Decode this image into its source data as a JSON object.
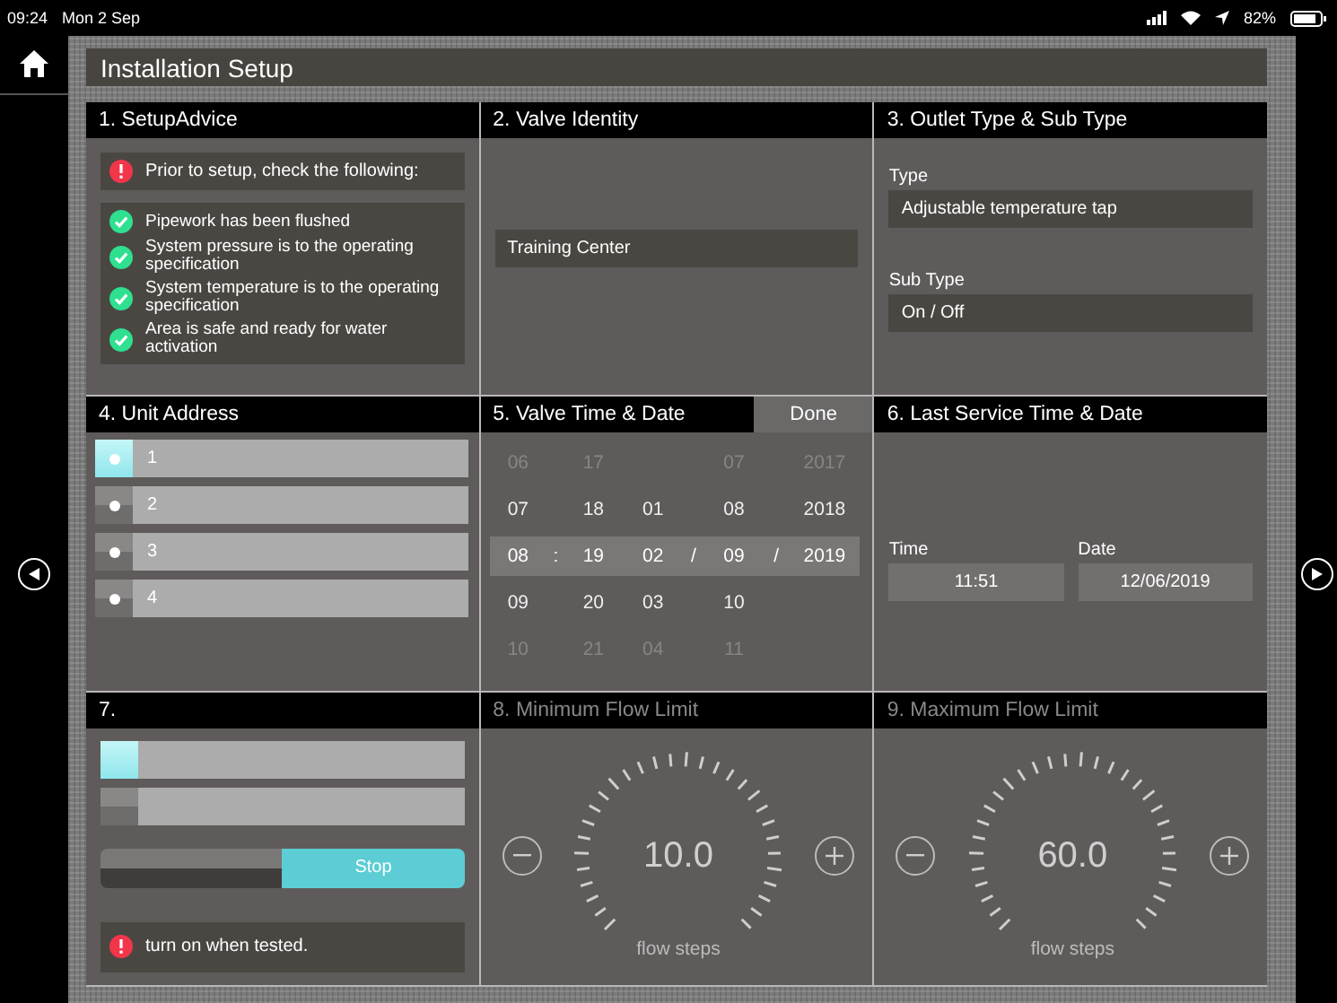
{
  "status_bar": {
    "time": "09:24",
    "date": "Mon 2 Sep",
    "battery": "82%"
  },
  "title": "Installation Setup",
  "advice": {
    "title": "1. SetupAdvice",
    "warning": "Prior to setup, check the following:",
    "checks": [
      {
        "text": "Pipework has been flushed",
        "checked": true
      },
      {
        "text": "System pressure is to the operating specification",
        "checked": true
      },
      {
        "text": "System temperature is to the operating specification",
        "checked": true
      },
      {
        "text": "Area is safe and ready for water activation",
        "checked": true
      }
    ]
  },
  "identity": {
    "title": "2. Valve Identity",
    "value": "Training Center"
  },
  "outlet": {
    "title": "3. Outlet Type & Sub Type",
    "fields": [
      {
        "label": "Type",
        "value": "Adjustable temperature tap"
      },
      {
        "label": "Sub Type",
        "value": "On / Off"
      }
    ]
  },
  "unit_address": {
    "title": "4. Unit Address",
    "items": [
      {
        "label": "1",
        "selected": true
      },
      {
        "label": "2",
        "selected": false
      },
      {
        "label": "3",
        "selected": false
      },
      {
        "label": "4",
        "selected": false
      }
    ]
  },
  "valve_time": {
    "title": "5. Valve Time & Date",
    "done": "Done",
    "time_separator": ":",
    "date_separator": "/",
    "hour": [
      {
        "text": "06",
        "selected": false
      },
      {
        "text": "07",
        "selected": false
      },
      {
        "text": "08",
        "selected": true
      },
      {
        "text": "09",
        "selected": false
      },
      {
        "text": "10",
        "selected": false
      }
    ],
    "minute": [
      {
        "text": "17",
        "selected": false
      },
      {
        "text": "18",
        "selected": false
      },
      {
        "text": "19",
        "selected": true
      },
      {
        "text": "20",
        "selected": false
      },
      {
        "text": "21",
        "selected": false
      }
    ],
    "day": [
      {
        "text": "01",
        "selected": false
      },
      {
        "text": "02",
        "selected": true
      },
      {
        "text": "03",
        "selected": false
      },
      {
        "text": "04",
        "selected": false
      }
    ],
    "month": [
      {
        "text": "07",
        "selected": false
      },
      {
        "text": "08",
        "selected": false
      },
      {
        "text": "09",
        "selected": true
      },
      {
        "text": "10",
        "selected": false
      },
      {
        "text": "11",
        "selected": false
      }
    ],
    "year": [
      {
        "text": "2017",
        "selected": false
      },
      {
        "text": "2018",
        "selected": false
      },
      {
        "text": "2019",
        "selected": true
      }
    ]
  },
  "last_service": {
    "title": "6. Last Service Time & Date",
    "fields": [
      {
        "label": "Time",
        "value": "11:51"
      },
      {
        "label": "Date",
        "value": "12/06/2019"
      }
    ]
  },
  "panel_7": {
    "title": "7.",
    "options": [
      {
        "selected": true
      },
      {
        "selected": false
      }
    ],
    "segments": [
      {
        "selected": false
      },
      {
        "label": "Stop",
        "selected": true
      }
    ],
    "warning": "turn on when tested."
  },
  "flow_limits": [
    {
      "title": "8. Minimum Flow Limit",
      "disabled": true,
      "value": "10.0",
      "unit": "flow steps"
    },
    {
      "title": "9. Maximum Flow Limit",
      "disabled": true,
      "value": "60.0",
      "unit": "flow steps"
    }
  ]
}
